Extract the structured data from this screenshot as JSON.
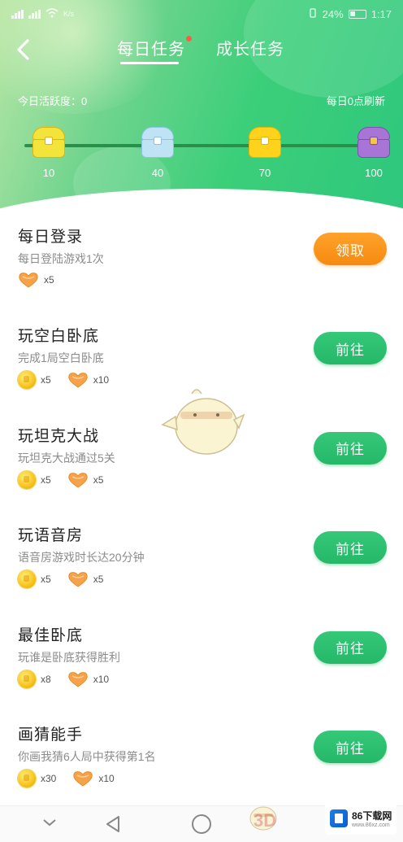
{
  "status_bar": {
    "left_text": "K/s",
    "battery_text": "24%",
    "time": "1:17"
  },
  "header": {
    "tabs": [
      {
        "label": "每日任务",
        "active": true,
        "has_dot": true
      },
      {
        "label": "成长任务",
        "active": false,
        "has_dot": false
      }
    ],
    "activity_label": "今日活跃度：0",
    "refresh_label": "每日0点刷新",
    "milestones": [
      {
        "value": "10",
        "chest_color": "#f2e43a"
      },
      {
        "value": "40",
        "chest_color": "#bfe3f5"
      },
      {
        "value": "70",
        "chest_color": "#ffd21c"
      },
      {
        "value": "100",
        "chest_color": "#a874d6"
      }
    ]
  },
  "tasks": [
    {
      "title": "每日登录",
      "desc": "每日登陆游戏1次",
      "rewards": [
        {
          "icon": "heart-coin-icon",
          "qty": "x5"
        }
      ],
      "button": {
        "label": "领取",
        "kind": "claim"
      }
    },
    {
      "title": "玩空白卧底",
      "desc": "完成1局空白卧底",
      "rewards": [
        {
          "icon": "gold-coin-icon",
          "qty": "x5"
        },
        {
          "icon": "heart-coin-icon",
          "qty": "x10"
        }
      ],
      "button": {
        "label": "前往",
        "kind": "go"
      }
    },
    {
      "title": "玩坦克大战",
      "desc": "玩坦克大战通过5关",
      "rewards": [
        {
          "icon": "gold-coin-icon",
          "qty": "x5"
        },
        {
          "icon": "heart-coin-icon",
          "qty": "x5"
        }
      ],
      "button": {
        "label": "前往",
        "kind": "go"
      }
    },
    {
      "title": "玩语音房",
      "desc": "语音房游戏时长达20分钟",
      "rewards": [
        {
          "icon": "gold-coin-icon",
          "qty": "x5"
        },
        {
          "icon": "heart-coin-icon",
          "qty": "x5"
        }
      ],
      "button": {
        "label": "前往",
        "kind": "go"
      }
    },
    {
      "title": "最佳卧底",
      "desc": "玩谁是卧底获得胜利",
      "rewards": [
        {
          "icon": "gold-coin-icon",
          "qty": "x8"
        },
        {
          "icon": "heart-coin-icon",
          "qty": "x10"
        }
      ],
      "button": {
        "label": "前往",
        "kind": "go"
      }
    },
    {
      "title": "画猜能手",
      "desc": "你画我猜6人局中获得第1名",
      "rewards": [
        {
          "icon": "gold-coin-icon",
          "qty": "x30"
        },
        {
          "icon": "heart-coin-icon",
          "qty": "x10"
        }
      ],
      "button": {
        "label": "前往",
        "kind": "go"
      }
    }
  ],
  "watermark": {
    "title": "86下载网",
    "subtitle": "www.86xz.com",
    "overlay": "3D"
  },
  "colors": {
    "header_green": "#2ec77c",
    "claim_orange": "#f68a10",
    "go_green": "#24b868",
    "progress_track": "#2b8f4c"
  }
}
